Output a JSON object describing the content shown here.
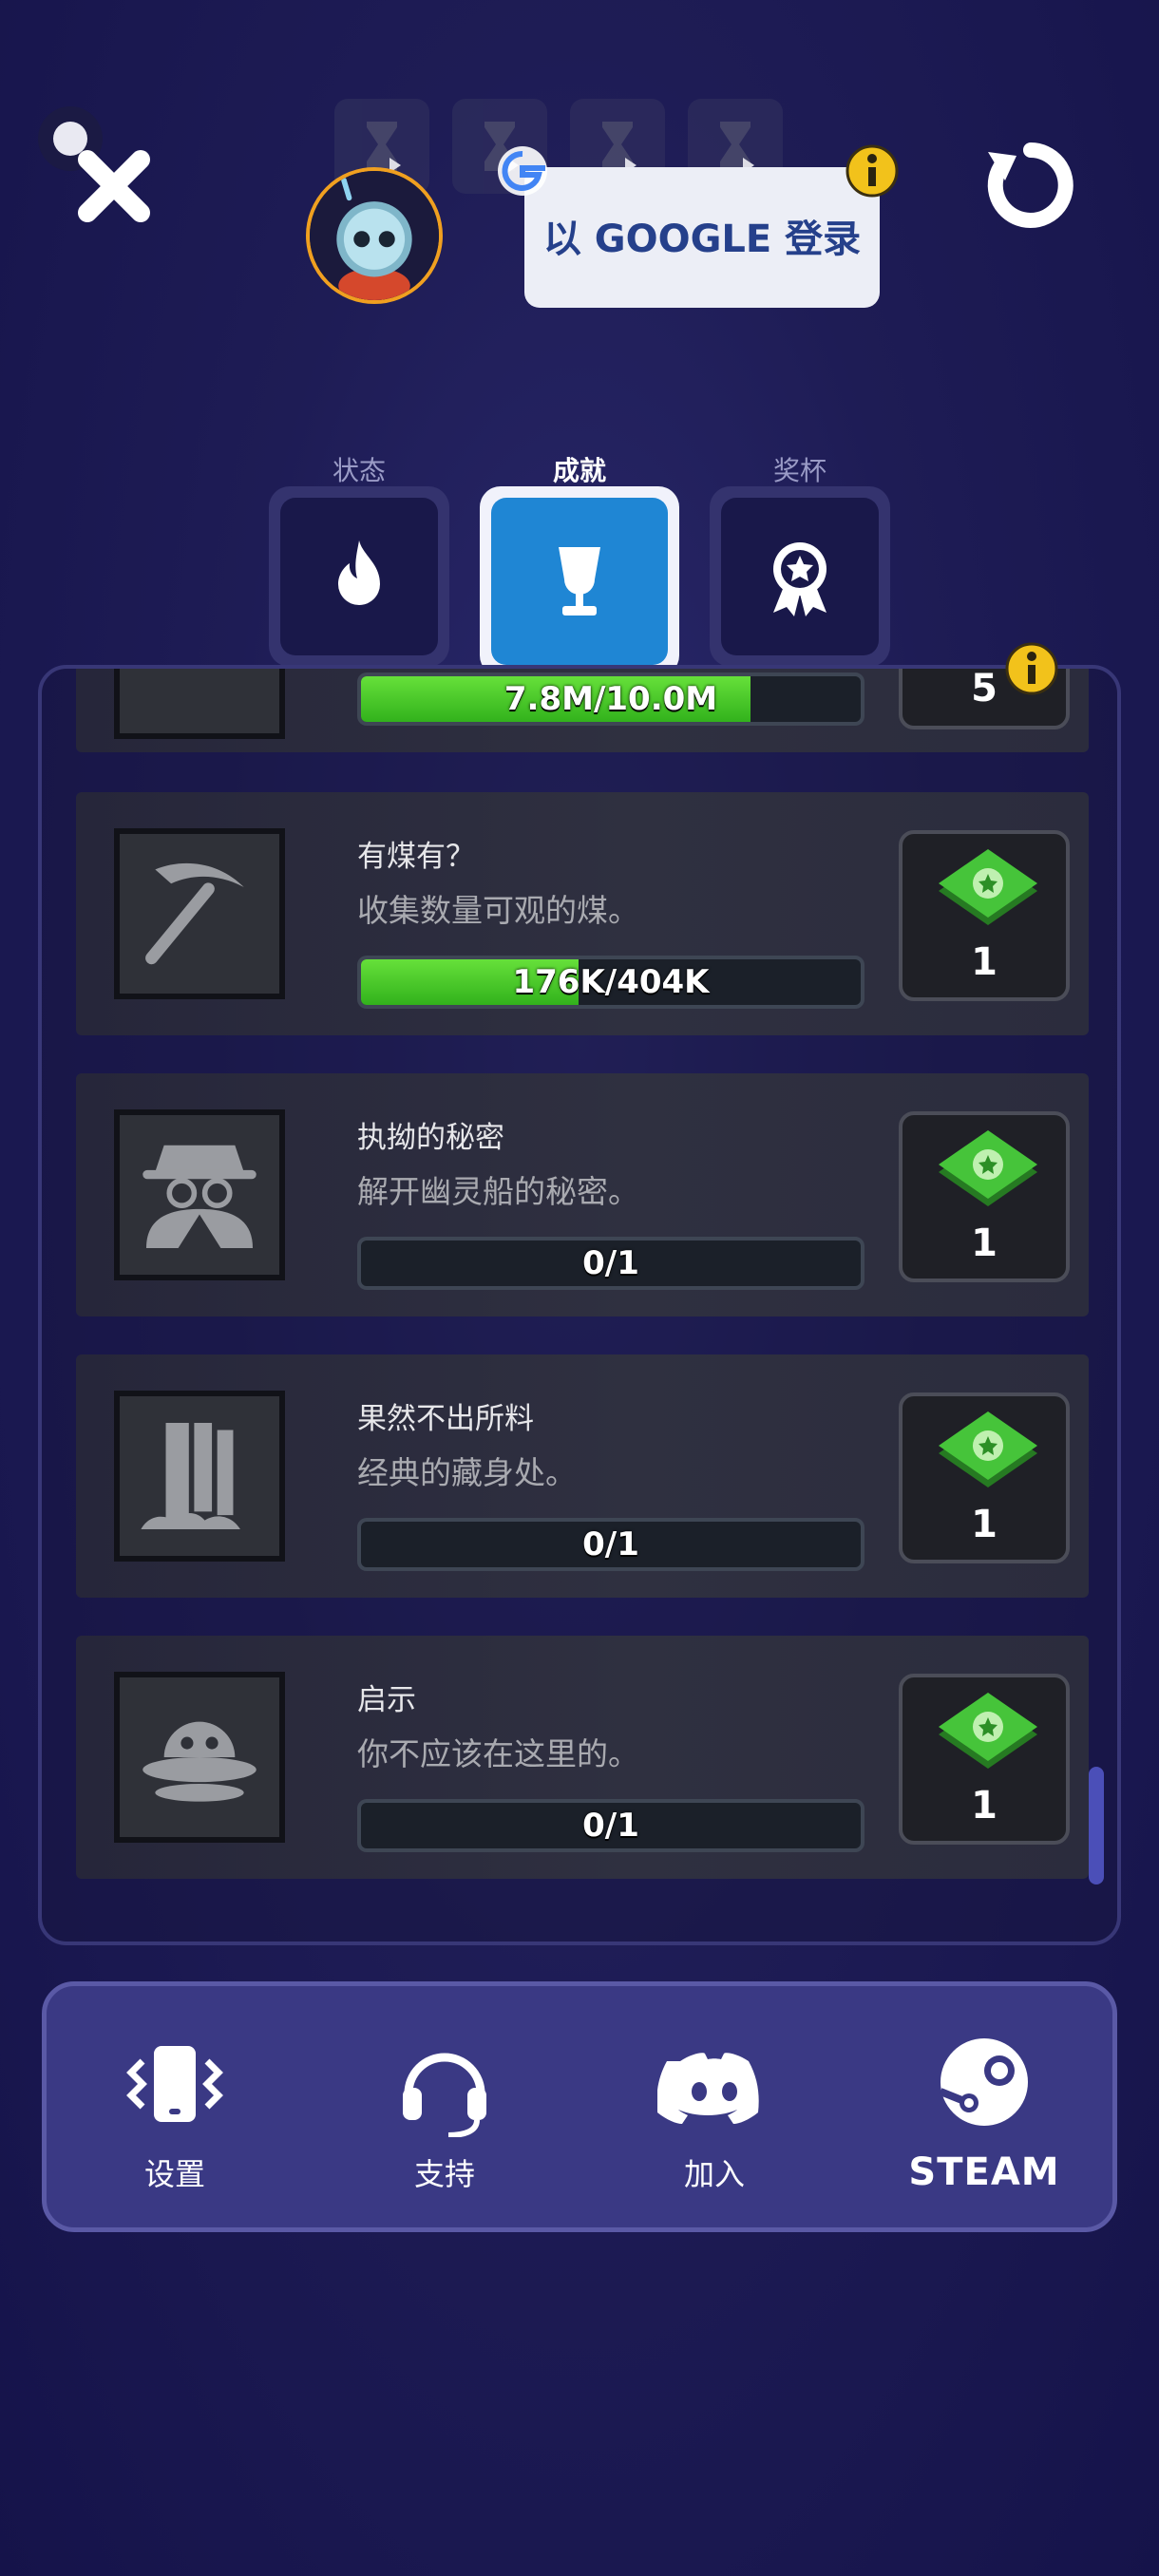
{
  "header": {
    "login_label": "以 GOOGLE 登录",
    "icons": [
      "close-icon",
      "hourglass-icon",
      "google-icon",
      "info-icon",
      "refresh-icon",
      "robot-avatar"
    ]
  },
  "tabs": [
    {
      "label": "状态",
      "icon": "flame-icon",
      "active": false
    },
    {
      "label": "成就",
      "icon": "trophy-icon",
      "active": true
    },
    {
      "label": "奖杯",
      "icon": "medal-icon",
      "active": false
    }
  ],
  "achievements": [
    {
      "title": "",
      "desc": "",
      "progress_text": "7.8M/10.0M",
      "progress": 0.78,
      "reward": "5"
    },
    {
      "title": "有煤有？",
      "desc": "收集数量可观的煤。",
      "progress_text": "176K/404K",
      "progress": 0.436,
      "reward": "1",
      "icon": "pickaxe-icon"
    },
    {
      "title": "执拗的秘密",
      "desc": "解开幽灵船的秘密。",
      "progress_text": "0/1",
      "progress": 0,
      "reward": "1",
      "icon": "spy-icon"
    },
    {
      "title": "果然不出所料",
      "desc": "经典的藏身处。",
      "progress_text": "0/1",
      "progress": 0,
      "reward": "1",
      "icon": "waterfall-icon"
    },
    {
      "title": "启示",
      "desc": "你不应该在这里的。",
      "progress_text": "0/1",
      "progress": 0,
      "reward": "1",
      "icon": "alien-ufo-icon"
    }
  ],
  "bottom_nav": [
    {
      "label": "设置",
      "icon": "phone-vibrate-icon"
    },
    {
      "label": "支持",
      "icon": "headset-icon"
    },
    {
      "label": "加入",
      "icon": "discord-icon"
    },
    {
      "label": "STEAM",
      "icon": "steam-icon"
    }
  ],
  "colors": {
    "accent": "#1f86d4",
    "progress": "#4fcf2c",
    "ticket": "#3fbf3a",
    "info": "#f2c21b"
  }
}
